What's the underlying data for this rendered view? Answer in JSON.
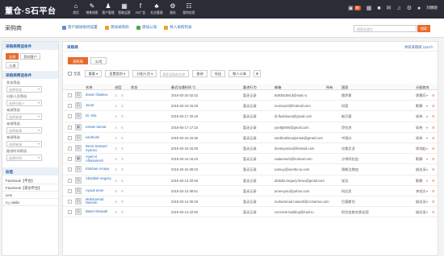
{
  "app": {
    "logo": "董仓·S石平台"
  },
  "nav": [
    {
      "icon": "⌂",
      "label": "首页"
    },
    {
      "icon": "✎",
      "label": "销售线索"
    },
    {
      "icon": "♟",
      "label": "客户管理"
    },
    {
      "icon": "▦",
      "label": "智能运营"
    },
    {
      "icon": "f",
      "label": "FB广告"
    },
    {
      "icon": "♣",
      "label": "社交管理"
    },
    {
      "icon": "⚙",
      "label": "服务"
    },
    {
      "icon": "☷",
      "label": "我的应用"
    }
  ],
  "topbar": {
    "badge": "新",
    "user": "刘晓晓"
  },
  "subheader": {
    "title": "采购商",
    "links": [
      "客户跟进规则设置",
      "添加采购商",
      "添加公海",
      "导入采购列表"
    ],
    "search_placeholder": "搜索关键字",
    "search_button": "搜索"
  },
  "sidebar": {
    "section1": "采购商筛选条件",
    "chips": [
      "全部",
      "我的客户",
      "公海"
    ],
    "section2": "采购商筛选条件",
    "filters": [
      {
        "label": "状态筛选",
        "value": "选择状态"
      },
      {
        "label": "分配人员筛选",
        "value": "选择分配人"
      },
      {
        "label": "来源筛选",
        "value": "选择来源"
      },
      {
        "label": "来源筛选",
        "value": "选择来源"
      },
      {
        "label": "来源筛选",
        "value": "选择来源"
      },
      {
        "label": "跟进时间筛选",
        "value": "选择时间"
      }
    ],
    "section3": "标签",
    "tags": [
      "Facebook【平台】",
      "Facebook【来访平台】",
      "Line",
      "ru_naida"
    ]
  },
  "main": {
    "title": "采购商",
    "count": "共有采购商 1113人",
    "tabs": [
      "采购商",
      "公司"
    ],
    "toolbar": {
      "select_all": "全选",
      "buttons": [
        "重要",
        "设置类别",
        "分配人员"
      ],
      "search_placeholder": "搜索采购商名称",
      "actions": [
        "查询",
        "导出",
        "移入公海"
      ],
      "icon_btn": "⊞"
    },
    "columns": [
      "名称",
      "进度",
      "状态",
      "最近沟通时间 ⇅",
      "跟进行为",
      "邮箱",
      "所有",
      "国家",
      "分配商名"
    ],
    "rows": [
      {
        "avatar": "G",
        "name": "Zewei Gkalexx",
        "date": "2019-03-20 02:42",
        "status": "暂无记录",
        "email": "5093616913@mail.ru",
        "owner": "俄罗斯",
        "group": "周慧芳"
      },
      {
        "avatar": "G",
        "name": "Junar",
        "date": "2019-03-19 15:26",
        "status": "暂无记录",
        "email": "musica22@hotmail.com",
        "owner": "印度",
        "group": "默静"
      },
      {
        "avatar": "G",
        "name": "Dr. Kila",
        "date": "2019-03-17 20:19",
        "status": "暂无记录",
        "email": "dr.fluebloura@gmail.com",
        "owner": "新巴基",
        "group": "如伟"
      },
      {
        "avatar": "▣",
        "name": "essam tamad",
        "date": "2019-03-17 17:15",
        "status": "暂无记录",
        "email": "yoe5j0000@gmail.com",
        "owner": "伊拉克",
        "group": "如伟"
      },
      {
        "avatar": "G",
        "name": "santhosh",
        "date": "2019-03-16 15:35",
        "status": "暂无记录",
        "email": "santhoshmanjunnat@gmail.com",
        "owner": "中国计",
        "group": "如伟"
      },
      {
        "avatar": "G",
        "name": "Devis Samwel Kyanza",
        "date": "2019-03-16 15:26",
        "status": "暂无记录",
        "email": "devanyanza@hotmail.com",
        "owner": "坦桑尼亚",
        "group": "再领起"
      },
      {
        "avatar": "▣",
        "name": "Ayad Al Alhasanneh",
        "date": "2019-03-15 15:23",
        "status": "暂无记录",
        "email": "nadamneh@hotmail.com",
        "owner": "沙特阿拉伯",
        "group": "默静"
      },
      {
        "avatar": "G",
        "name": "Esteban Amaya",
        "date": "2019-03-15 09:03",
        "status": "暂无记录",
        "email": "eamuy@veretto-ia.com",
        "owner": "哥斯达黎加",
        "group": "姚总深"
      },
      {
        "avatar": "G",
        "name": "Abdallah Hegazy",
        "date": "2019-03-14 20:56",
        "status": "暂无记录",
        "email": "abdulla.hegazy.faroa@gmail.com",
        "owner": "埃及",
        "group": "默静"
      },
      {
        "avatar": "G",
        "name": "Ayoub amer",
        "date": "2019-03-14 08:51",
        "status": "暂无记录",
        "email": "ameruyou@yahoo.com",
        "owner": "科比亚",
        "group": "李绍文"
      },
      {
        "avatar": "G",
        "name": "Muhammad Naseeb",
        "date": "2019-03-14 05:49",
        "status": "暂无记录",
        "email": "muhammad.naseeb@ccmarma.com",
        "owner": "巴基斯坦",
        "group": "姚总深"
      },
      {
        "avatar": "G",
        "name": "Basel Alsawah",
        "date": "2019-03-13 22:50",
        "status": "暂无记录",
        "email": "concrete-building@mail.ru",
        "owner": "阿拉伯联合酋长国",
        "group": "姚总深"
      }
    ]
  }
}
